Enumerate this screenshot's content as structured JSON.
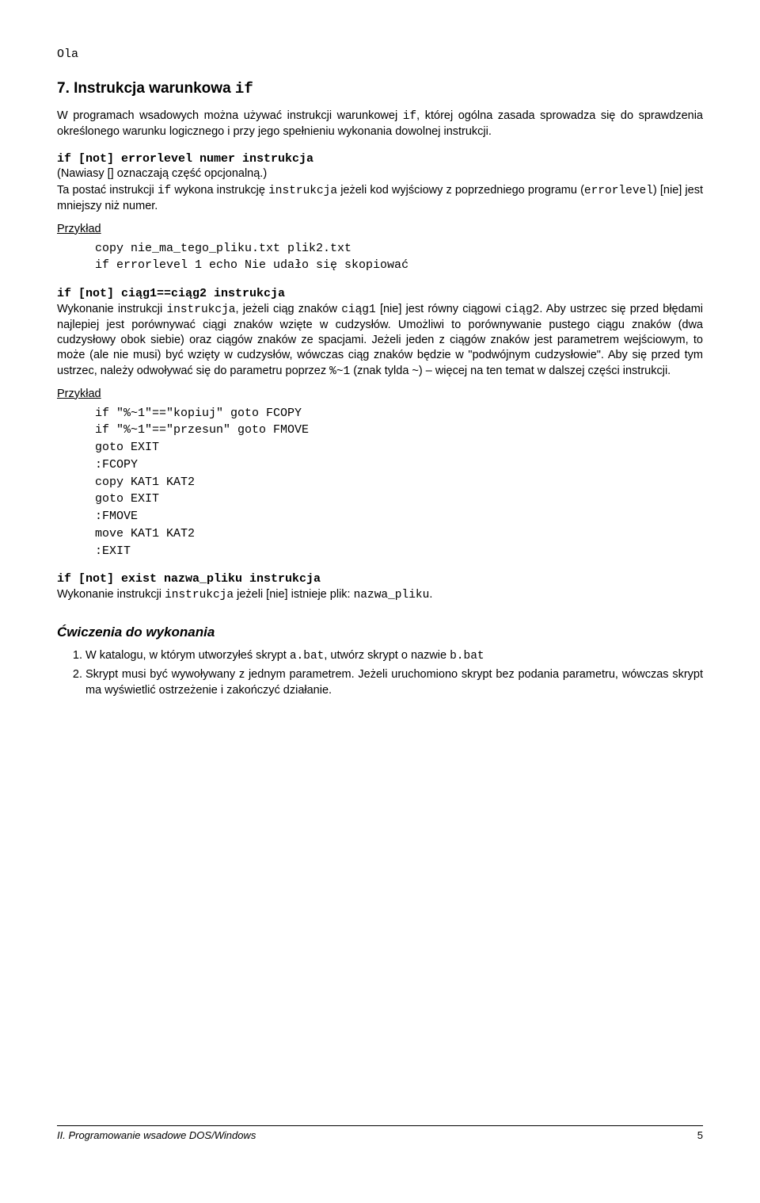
{
  "top_name": "Ola",
  "section7": {
    "heading_pre": "7. Instrukcja warunkowa ",
    "heading_code": "if",
    "intro_pre": "W programach wsadowych można używać instrukcji warunkowej ",
    "intro_code1": "if",
    "intro_post": ", której ogólna zasada sprowadza się do sprawdzenia określonego warunku logicznego i przy jego spełnieniu wykonania dowolnej instrukcji.",
    "form1_heading": "if [not] errorlevel numer instrukcja",
    "form1_note": "(Nawiasy [] oznaczają część opcjonalną.)",
    "form1_p_a": "Ta postać instrukcji ",
    "form1_p_b": "if",
    "form1_p_c": " wykona instrukcję ",
    "form1_p_d": "instrukcja",
    "form1_p_e": " jeżeli kod wyjściowy z poprzedniego programu (",
    "form1_p_f": "errorlevel",
    "form1_p_g": ") [nie] jest mniejszy niż numer.",
    "ex_label": "Przykład",
    "code1": "copy nie_ma_tego_pliku.txt plik2.txt\nif errorlevel 1 echo Nie udało się skopiować",
    "form2_heading": "if [not] ciąg1==ciąg2 instrukcja",
    "form2_p_a": "Wykonanie instrukcji ",
    "form2_p_b": "instrukcja",
    "form2_p_c": ", jeżeli ciąg znaków ",
    "form2_p_d": "ciąg1",
    "form2_p_e": " [nie] jest równy ciągowi ",
    "form2_p_f": "ciąg2",
    "form2_p_g": ". Aby ustrzec się przed błędami najlepiej jest porównywać ciągi znaków wzięte w cudzysłów. Umożliwi to porównywanie pustego ciągu znaków (dwa cudzysłowy obok siebie) oraz ciągów znaków ze spacjami. Jeżeli jeden z ciągów znaków jest parametrem wejściowym, to może (ale nie musi) być wzięty w cudzysłów, wówczas ciąg znaków będzie w \"podwójnym cudzysłowie\". Aby się przed tym ustrzec, należy odwoływać się do parametru poprzez ",
    "form2_p_h": "%~1",
    "form2_p_i": " (znak tylda ~) – więcej na ten temat w dalszej części instrukcji.",
    "code2": "if \"%~1\"==\"kopiuj\" goto FCOPY\nif \"%~1\"==\"przesun\" goto FMOVE\ngoto EXIT\n:FCOPY\ncopy KAT1 KAT2\ngoto EXIT\n:FMOVE\nmove KAT1 KAT2\n:EXIT",
    "form3_heading": "if [not] exist nazwa_pliku instrukcja",
    "form3_p_a": "Wykonanie instrukcji ",
    "form3_p_b": "instrukcja",
    "form3_p_c": " jeżeli [nie] istnieje plik: ",
    "form3_p_d": "nazwa_pliku",
    "form3_p_e": "."
  },
  "exercises": {
    "heading": "Ćwiczenia do wykonania",
    "items": {
      "i1_a": "W katalogu, w którym utworzyłeś skrypt ",
      "i1_b": "a.bat",
      "i1_c": ", utwórz skrypt o nazwie ",
      "i1_d": "b.bat",
      "i2": "Skrypt musi być wywoływany z jednym parametrem. Jeżeli uruchomiono skrypt bez podania parametru, wówczas skrypt ma wyświetlić ostrzeżenie i zakończyć działanie."
    }
  },
  "footer": {
    "title": "II. Programowanie wsadowe DOS/Windows",
    "page": "5"
  }
}
